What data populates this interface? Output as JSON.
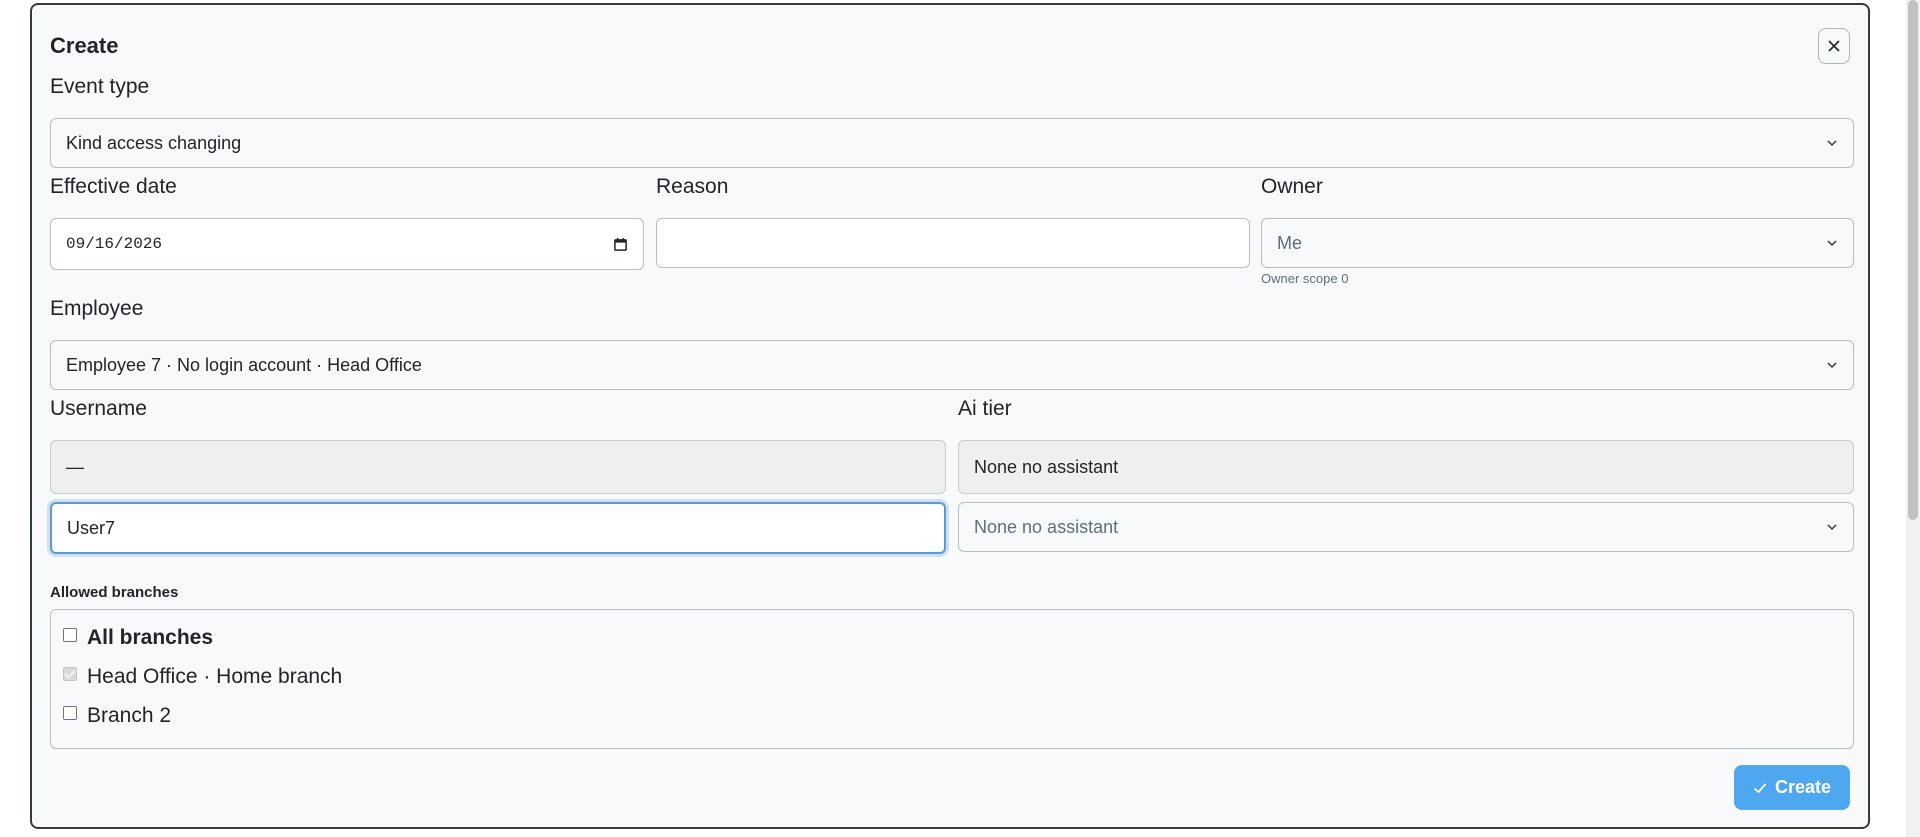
{
  "modal": {
    "title": "Create",
    "close_icon": "close-icon"
  },
  "event_type": {
    "label": "Event type",
    "value": "Kind access changing"
  },
  "effective_date": {
    "label": "Effective date",
    "value": "09/16/2026",
    "icon": "calendar-icon"
  },
  "reason": {
    "label": "Reason",
    "value": ""
  },
  "owner": {
    "label": "Owner",
    "value": "Me",
    "hint": "Owner scope 0"
  },
  "employee": {
    "label": "Employee",
    "value": "Employee 7 · No login account · Head Office"
  },
  "username": {
    "label": "Username",
    "current": "—",
    "new_value": "User7"
  },
  "ai_tier": {
    "label": "Ai tier",
    "current": "None no assistant",
    "new_value": "None no assistant"
  },
  "allowed_branches": {
    "label": "Allowed branches",
    "items": [
      {
        "label": "All branches",
        "checked": false,
        "disabled": false,
        "bold": true
      },
      {
        "label": "Head Office · Home branch",
        "checked": true,
        "disabled": true,
        "bold": false
      },
      {
        "label": "Branch 2",
        "checked": false,
        "disabled": false,
        "bold": false
      }
    ]
  },
  "actions": {
    "create_label": "Create",
    "create_icon": "check-icon"
  },
  "colors": {
    "primary": "#4fa7ef",
    "focus": "#5b9bd5",
    "modal_border": "#343a40"
  }
}
